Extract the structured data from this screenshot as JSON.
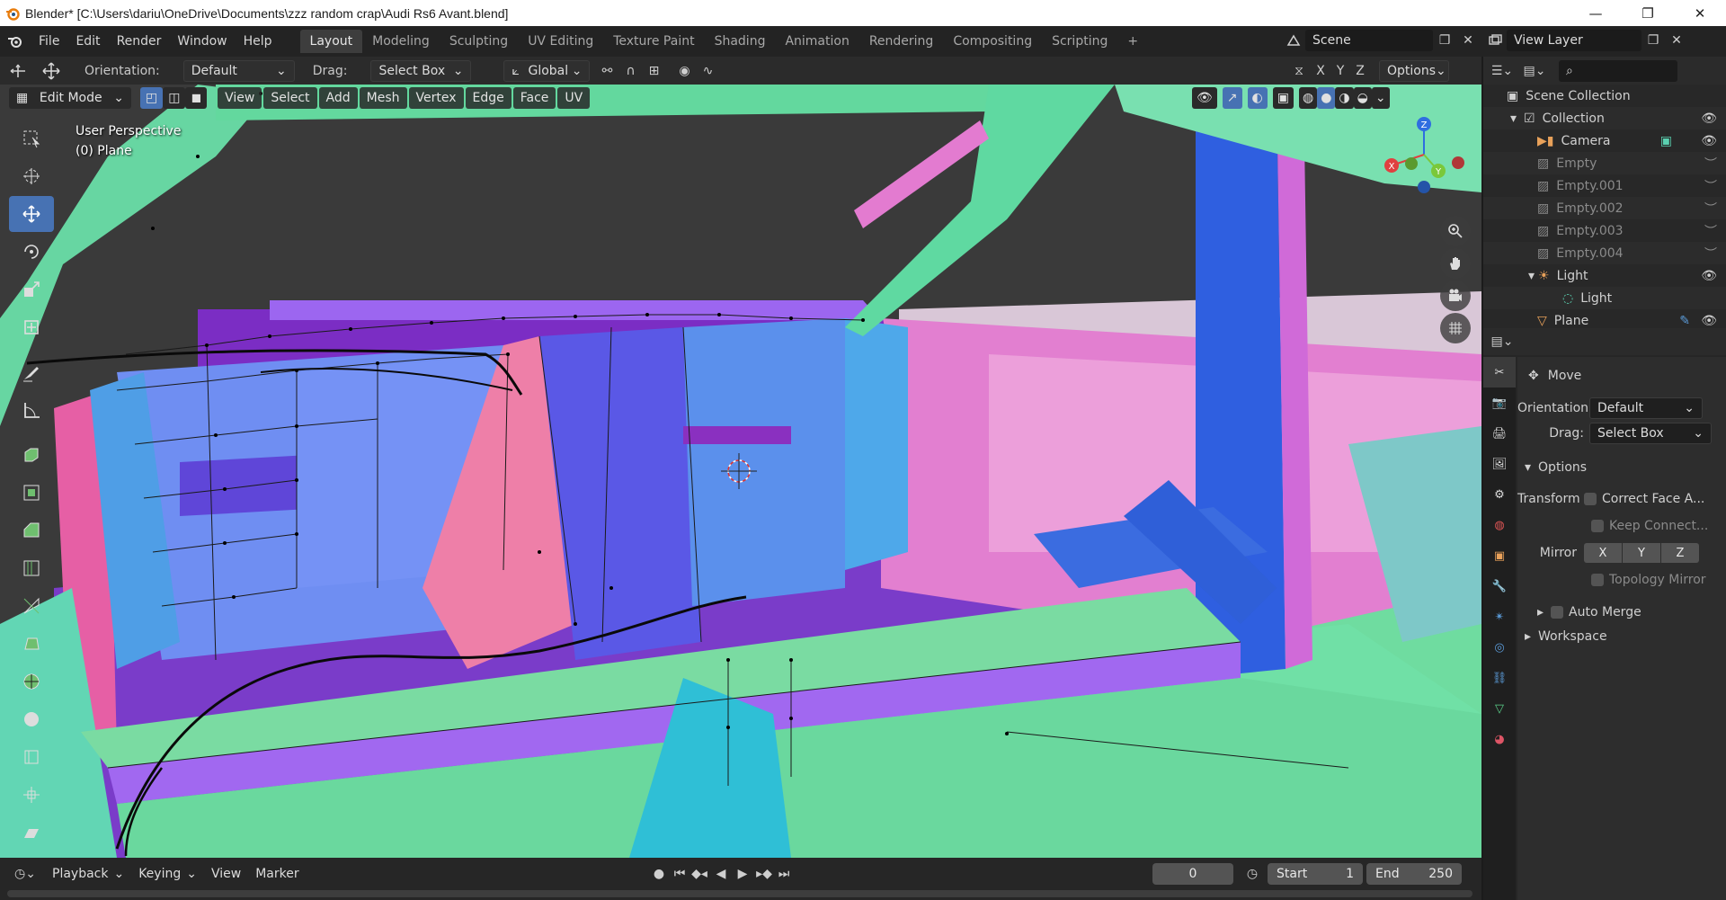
{
  "window": {
    "title": "Blender* [C:\\Users\\dariu\\OneDrive\\Documents\\zzz random crap\\Audi Rs6 Avant.blend]",
    "minimize": "—",
    "maximize": "❐",
    "close": "✕"
  },
  "menubar": {
    "items": [
      "File",
      "Edit",
      "Render",
      "Window",
      "Help"
    ],
    "workspaces": [
      "Layout",
      "Modeling",
      "Sculpting",
      "UV Editing",
      "Texture Paint",
      "Shading",
      "Animation",
      "Rendering",
      "Compositing",
      "Scripting"
    ],
    "active_workspace": "Layout",
    "add_tab": "+",
    "scene": "Scene",
    "view_layer": "View Layer"
  },
  "toolheader": {
    "orientation_label": "Orientation:",
    "orientation_value": "Default",
    "drag_label": "Drag:",
    "drag_value": "Select Box",
    "transform_orientation": "Global",
    "axes": [
      "X",
      "Y",
      "Z"
    ],
    "options": "Options"
  },
  "viewport": {
    "mode": "Edit Mode",
    "menus": [
      "View",
      "Select",
      "Add",
      "Mesh",
      "Vertex",
      "Edge",
      "Face",
      "UV"
    ],
    "overlay_line1": "User Perspective",
    "overlay_line2": "(0) Plane",
    "gizmo_axes": [
      "X",
      "Y",
      "Z"
    ]
  },
  "timeline": {
    "menus": [
      "Playback",
      "Keying",
      "View",
      "Marker"
    ],
    "current_frame": "0",
    "start_label": "Start",
    "start_value": "1",
    "end_label": "End",
    "end_value": "250"
  },
  "outliner": {
    "root": "Scene Collection",
    "items": [
      {
        "label": "Collection",
        "dim": false
      },
      {
        "label": "Camera",
        "dim": false
      },
      {
        "label": "Empty",
        "dim": true
      },
      {
        "label": "Empty.001",
        "dim": true
      },
      {
        "label": "Empty.002",
        "dim": true
      },
      {
        "label": "Empty.003",
        "dim": true
      },
      {
        "label": "Empty.004",
        "dim": true
      },
      {
        "label": "Light",
        "dim": false
      },
      {
        "label": "Light",
        "dim": false
      },
      {
        "label": "Plane",
        "dim": false
      }
    ]
  },
  "properties": {
    "operator": "Move",
    "orientation_label": "Orientation",
    "orientation_value": "Default",
    "drag_label": "Drag:",
    "drag_value": "Select Box",
    "options_panel": "Options",
    "transform_label": "Transform",
    "correct_face": "Correct Face A...",
    "keep_connected": "Keep Connect...",
    "mirror_label": "Mirror",
    "mirror_axes": [
      "X",
      "Y",
      "Z"
    ],
    "topology_mirror": "Topology Mirror",
    "auto_merge": "Auto Merge",
    "workspace_panel": "Workspace"
  },
  "colors": {
    "accent": "#4772b3",
    "title_bg": "#ffffff",
    "ui_bg": "#232323",
    "mesh_green": "#6fdc9f",
    "mesh_purple": "#8a3fd6",
    "mesh_blue": "#5b7fe8",
    "mesh_pink": "#e86fb8"
  }
}
